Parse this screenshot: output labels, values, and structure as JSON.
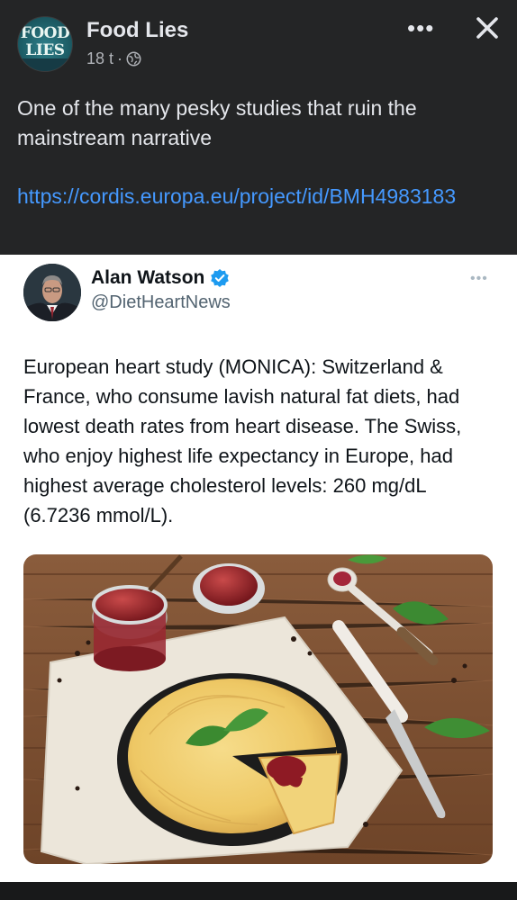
{
  "post": {
    "page_name": "Food Lies",
    "avatar_text_line1": "FOOD",
    "avatar_text_line2": "LIES",
    "time": "18 t",
    "separator": "·",
    "text": "One of the many pesky studies that ruin the mainstream narrative",
    "link": "https://cordis.europa.eu/project/id/BMH4983183",
    "more_icon": "more-horizontal-icon",
    "close_icon": "close-icon",
    "privacy_icon": "globe-icon"
  },
  "tweet": {
    "name": "Alan Watson",
    "handle": "@DietHeartNews",
    "verified_color": "#1d9bf0",
    "text": "European heart study (MONICA): Switzerland & France, who consume lavish natural fat diets, had lowest death rates from heart disease. The Swiss, who enjoy highest life expectancy in Europe, had highest average cholesterol levels: 260 mg/dL (6.7236 mmol/L).",
    "image_description_icon": "cheese-pie-photo"
  },
  "colors": {
    "background": "#242526",
    "text_primary": "#e4e6eb",
    "text_secondary": "#b0b3b8",
    "link": "#4599ff"
  }
}
